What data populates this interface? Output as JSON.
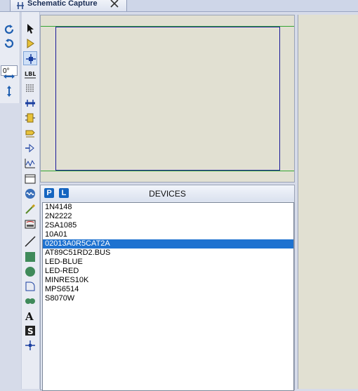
{
  "tab": {
    "label": "Schematic Capture",
    "icon": "schematic-icon",
    "close_icon": "close-icon"
  },
  "rotation": {
    "angle": "0°",
    "buttons": [
      "rotate-cw-icon",
      "rotate-ccw-icon",
      "flip-horizontal-icon",
      "flip-vertical-icon"
    ]
  },
  "tools": [
    "select-icon",
    "component-icon",
    "junction-icon",
    "wire-label-icon",
    "text-script-icon",
    "bus-icon",
    "subcircuit-icon",
    "terminal-icon",
    "device-pin-icon",
    "graph-icon",
    "tape-recorder-icon",
    "generator-icon",
    "voltage-probe-icon",
    "instrument-icon",
    "line-icon",
    "box-icon",
    "circle-icon",
    "arc-icon",
    "path-icon",
    "text-icon",
    "symbol-icon",
    "marker-icon"
  ],
  "colors": {
    "selection": "#1e72d0",
    "panel_bg": "#e1e0d2",
    "sheet_border": "#1a1a9a",
    "margin_line": "#33a533"
  },
  "devices": {
    "title": "DEVICES",
    "pick_button": "P",
    "library_button": "L",
    "items": [
      "1N4148",
      "2N2222",
      "2SA1085",
      "10A01",
      "02013A0R5CAT2A",
      "AT89C51RD2.BUS",
      "LED-BLUE",
      "LED-RED",
      "MINRES10K",
      "MPS6514",
      "S8070W"
    ],
    "selected": "02013A0R5CAT2A"
  }
}
